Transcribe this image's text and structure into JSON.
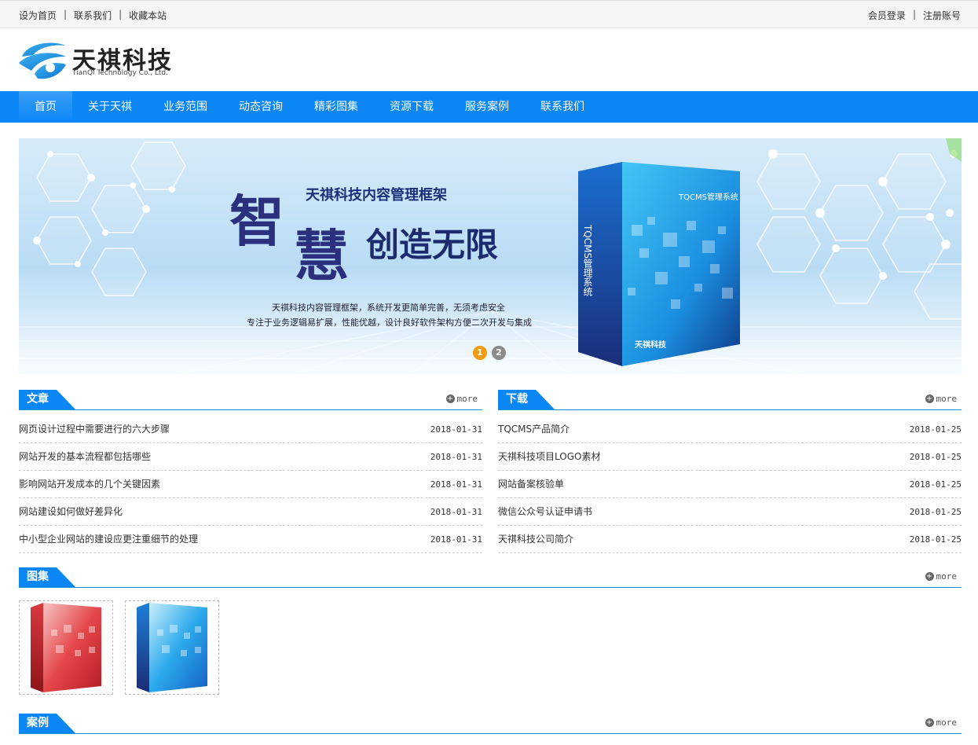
{
  "topbar": {
    "left": [
      "设为首页",
      "联系我们",
      "收藏本站"
    ],
    "right": [
      "会员登录",
      "注册账号"
    ]
  },
  "logo": {
    "cn": "天祺科技",
    "en": "TianQi Technology Co., Ltd."
  },
  "nav": [
    "首页",
    "关于天祺",
    "业务范围",
    "动态咨询",
    "精彩图集",
    "资源下载",
    "服务案例",
    "联系我们"
  ],
  "banner": {
    "title": "天祺科技内容管理框架",
    "big1": "智",
    "big2": "慧",
    "big3": "创造无限",
    "line1": "天祺科技内容管理框架，系统开发更简单完善，无须考虑安全",
    "line2": "专注于业务逻辑易扩展，性能优越，设计良好软件架构方便二次开发与集成",
    "box_title": "TQCMS管理系统",
    "box_side": "TQCMS管理系统",
    "box_brand": "天祺科技",
    "dots": [
      "1",
      "2"
    ]
  },
  "more_label": "more",
  "articles": {
    "title": "文章",
    "items": [
      {
        "title": "网页设计过程中需要进行的六大步骤",
        "date": "2018-01-31"
      },
      {
        "title": "网站开发的基本流程都包括哪些",
        "date": "2018-01-31"
      },
      {
        "title": "影响网站开发成本的几个关键因素",
        "date": "2018-01-31"
      },
      {
        "title": "网站建设如何做好差异化",
        "date": "2018-01-31"
      },
      {
        "title": "中小型企业网站的建设应更注重细节的处理",
        "date": "2018-01-31"
      }
    ]
  },
  "downloads": {
    "title": "下载",
    "items": [
      {
        "title": "TQCMS产品简介",
        "date": "2018-01-25"
      },
      {
        "title": "天祺科技项目LOGO素材",
        "date": "2018-01-25"
      },
      {
        "title": "网站备案核验单",
        "date": "2018-01-25"
      },
      {
        "title": "微信公众号认证申请书",
        "date": "2018-01-25"
      },
      {
        "title": "天祺科技公司简介",
        "date": "2018-01-25"
      }
    ]
  },
  "gallery": {
    "title": "图集"
  },
  "cases": {
    "title": "案例"
  },
  "colors": {
    "primary": "#0a86f5",
    "accent": "#f39c12"
  }
}
